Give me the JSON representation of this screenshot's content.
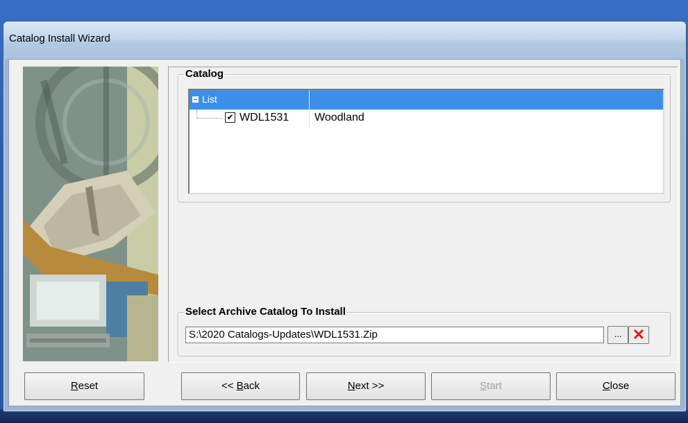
{
  "window": {
    "title": "Catalog Install Wizard"
  },
  "catalog_group": {
    "label": "Catalog",
    "tree_header": "List",
    "items": [
      {
        "checked": true,
        "code": "WDL1531",
        "name": "Woodland"
      }
    ]
  },
  "archive_group": {
    "label": "Select Archive Catalog To Install",
    "path_value": "S:\\2020 Catalogs-Updates\\WDL1531.Zip",
    "browse_label": "...",
    "clear_icon": "red-x-icon"
  },
  "buttons": {
    "reset": {
      "mnemonic": "R",
      "rest": "eset"
    },
    "back": {
      "prefix": "<< ",
      "mnemonic": "B",
      "rest": "ack"
    },
    "next": {
      "mnemonic": "N",
      "rest": "ext >>"
    },
    "start": {
      "mnemonic": "S",
      "rest": "tart",
      "enabled": false
    },
    "close": {
      "mnemonic": "C",
      "rest": "lose"
    }
  },
  "colors": {
    "tree_header_bg": "#3c8fe8",
    "clear_icon": "#e01a1a"
  }
}
